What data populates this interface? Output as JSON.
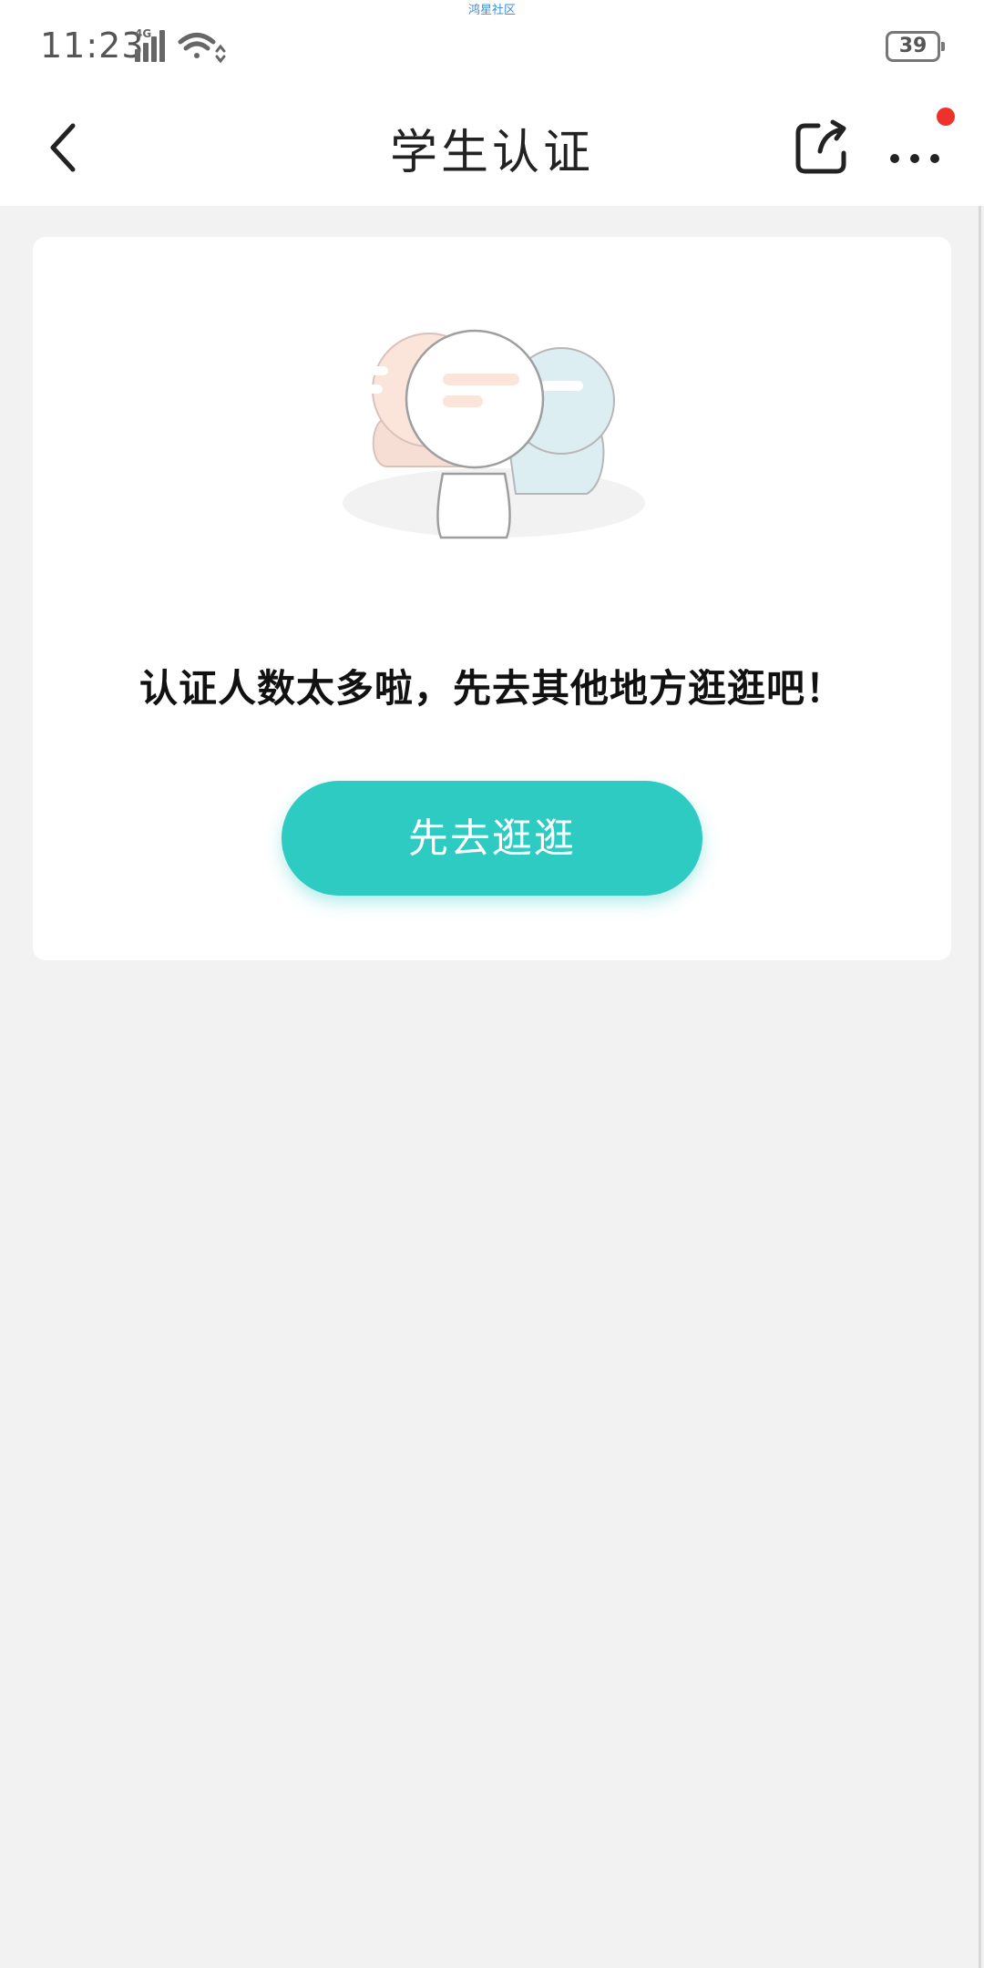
{
  "status_bar": {
    "time": "11:23",
    "network_label": "4G",
    "carrier_text": "鸿星社区",
    "battery": "39",
    "icons": [
      "signal-icon",
      "wifi-icon",
      "battery-icon"
    ]
  },
  "nav": {
    "title": "学生认证",
    "icons": [
      "back-chevron-icon",
      "share-icon",
      "more-dots-icon"
    ],
    "has_notification_dot": true
  },
  "content": {
    "empty_message": "认证人数太多啦，先去其他地方逛逛吧！",
    "button_label": "先去逛逛",
    "illustration": "chat-people-illustration"
  },
  "colors": {
    "accent": "#2ecbc2",
    "notification": "#f0302b",
    "background": "#f2f2f2",
    "card": "#ffffff"
  }
}
